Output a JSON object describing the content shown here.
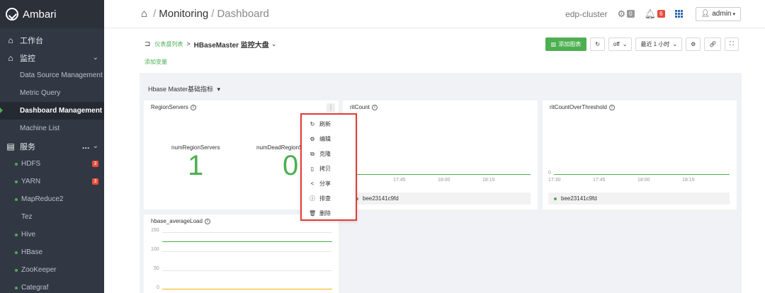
{
  "app": {
    "name": "Ambari"
  },
  "sidebar": {
    "workbench": "工作台",
    "monitor": "监控",
    "monitor_items": [
      "Data Source Management",
      "Metric Query",
      "Dashboard Management",
      "Machine List"
    ],
    "services": "服务",
    "service_items": [
      {
        "label": "HDFS",
        "badge": "3",
        "dot": true
      },
      {
        "label": "YARN",
        "badge": "3",
        "dot": true
      },
      {
        "label": "MapReduce2",
        "badge": "",
        "dot": true
      },
      {
        "label": "Tez",
        "badge": "",
        "dot": false
      },
      {
        "label": "Hive",
        "badge": "",
        "dot": true
      },
      {
        "label": "HBase",
        "badge": "",
        "dot": true
      },
      {
        "label": "ZooKeeper",
        "badge": "",
        "dot": true
      },
      {
        "label": "Categraf",
        "badge": "",
        "dot": true
      }
    ]
  },
  "header": {
    "crumb_root": "Monitoring",
    "crumb_current": "Dashboard",
    "cluster": "edp-cluster",
    "ops_count": "0",
    "alert_count": "6",
    "user": "admin"
  },
  "toolbar": {
    "list_link": "仪表盘列表",
    "dashboard_name": "HBaseMaster 监控大盘",
    "add_chart": "添加图表",
    "refresh_mode": "off",
    "time_range": "最近 1 小时",
    "add_variable": "添加变量"
  },
  "group": {
    "title": "Hbase Master基础指标"
  },
  "panels": {
    "region_servers": {
      "title": "RegionServers",
      "stat1_label": "numRegionServers",
      "stat1_value": "1",
      "stat2_label": "numDeadRegionS",
      "stat2_value": "0"
    },
    "rit_count": {
      "title": "ritCount",
      "ticks": [
        "17:45",
        "18:00",
        "18:15"
      ],
      "legend": "bee23141c9fd"
    },
    "rit_over": {
      "title": "ritCountOverThreshold",
      "y0": "0",
      "ticks": [
        "17:30",
        "17:45",
        "18:00",
        "18:15"
      ],
      "legend": "bee23141c9fd"
    },
    "avg_load": {
      "title": "hbase_averageLoad",
      "yticks": [
        "150",
        "100",
        "50",
        "0"
      ]
    }
  },
  "context_menu": {
    "items": [
      {
        "icon": "refresh-icon",
        "label": "刷新"
      },
      {
        "icon": "gear-icon",
        "label": "编辑"
      },
      {
        "icon": "clone-icon",
        "label": "克隆"
      },
      {
        "icon": "copy-icon",
        "label": "拷贝"
      },
      {
        "icon": "share-icon",
        "label": "分享"
      },
      {
        "icon": "info-icon",
        "label": "排查"
      },
      {
        "icon": "trash-icon",
        "label": "删除"
      }
    ]
  },
  "colors": {
    "sidebar": "#323843",
    "accent": "#4caf50",
    "danger": "#e74c3c",
    "load_line": "#f5b400"
  }
}
